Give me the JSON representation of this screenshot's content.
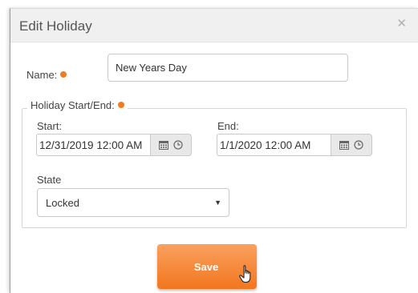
{
  "dialog": {
    "title": "Edit Holiday",
    "close_icon": "close-icon"
  },
  "form": {
    "name_label": "Name:",
    "name_value": "New Years Day",
    "holiday_legend": "Holiday Start/End:",
    "start_label": "Start:",
    "start_value": "12/31/2019 12:00 AM",
    "end_label": "End:",
    "end_value": "1/1/2020 12:00 AM",
    "state_label": "State",
    "state_value": "Locked"
  },
  "actions": {
    "save_label": "Save"
  },
  "icons": {
    "calendar": "calendar-icon",
    "clock": "clock-icon",
    "required": "required-indicator-dot",
    "caret": "chevron-down-icon",
    "cursor": "hand-pointer-cursor"
  },
  "colors": {
    "accent": "#f47a20",
    "header_bg": "#f0f0f0",
    "addon_bg": "#e8e8e8"
  }
}
